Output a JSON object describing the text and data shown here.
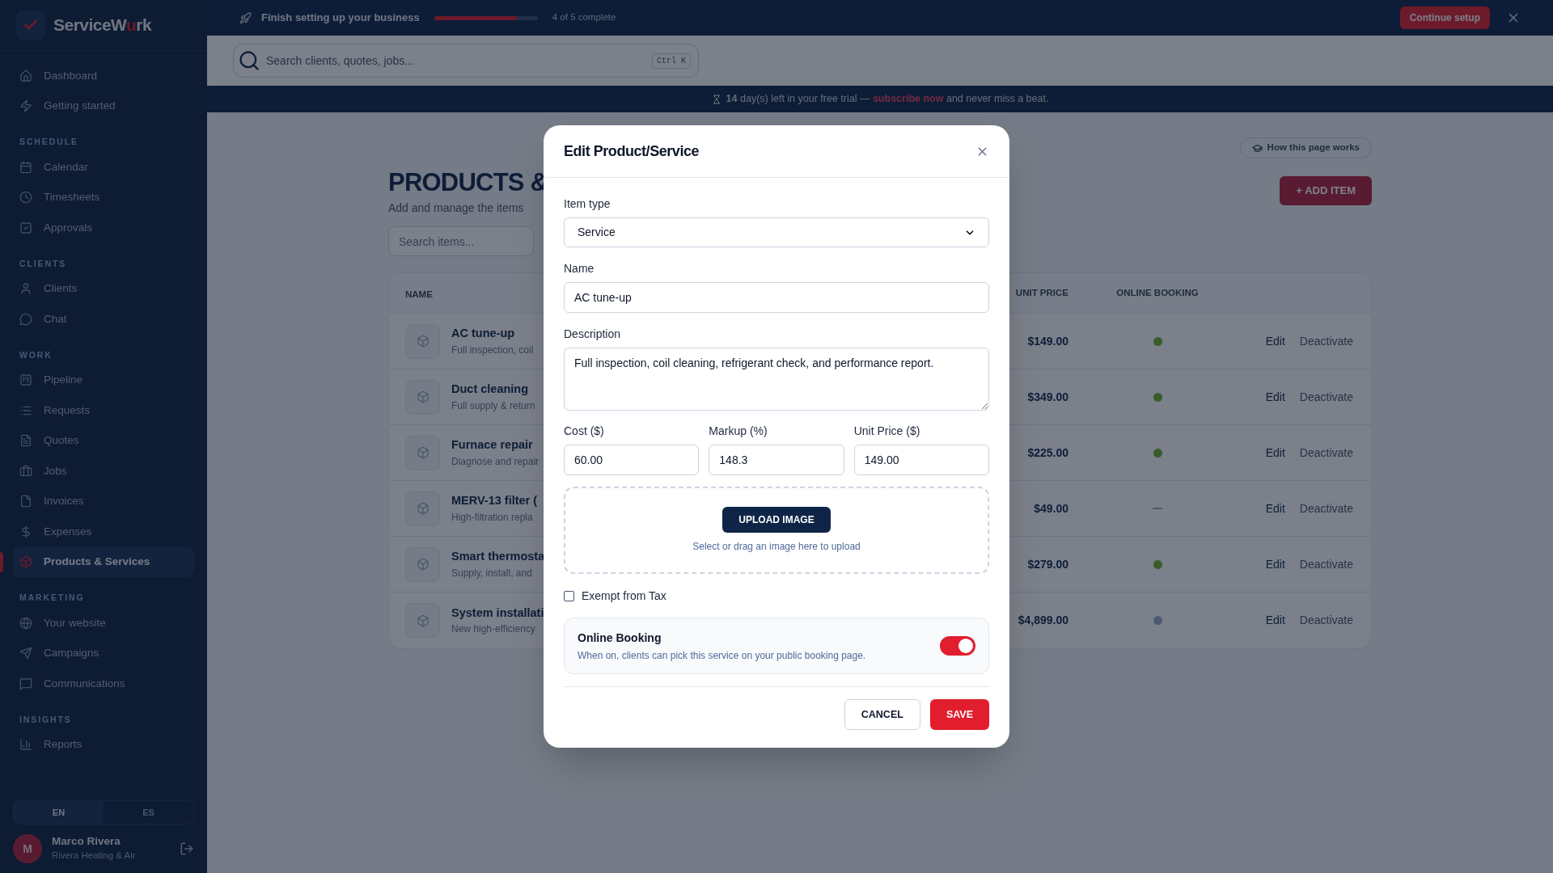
{
  "setup_bar": {
    "title": "Finish setting up your business",
    "level": 0.8,
    "progress_text": "4 of 5 complete",
    "button": "Continue setup"
  },
  "brand": {
    "name_start": "ServiceW",
    "name_accent": "u",
    "name_end": "rk"
  },
  "sidebar": {
    "sections": [
      {
        "items": [
          {
            "label": "Dashboard",
            "selected": false
          },
          {
            "label": "Getting started",
            "selected": false
          }
        ]
      },
      {
        "heading": "SCHEDULE",
        "items": [
          {
            "label": "Calendar",
            "selected": false
          },
          {
            "label": "Timesheets",
            "selected": false
          },
          {
            "label": "Approvals",
            "selected": false
          }
        ]
      },
      {
        "heading": "CLIENTS",
        "items": [
          {
            "label": "Clients",
            "selected": false
          },
          {
            "label": "Chat",
            "selected": false
          }
        ]
      },
      {
        "heading": "WORK",
        "items": [
          {
            "label": "Pipeline",
            "selected": false
          },
          {
            "label": "Requests",
            "selected": false
          },
          {
            "label": "Quotes",
            "selected": false
          },
          {
            "label": "Jobs",
            "selected": false
          },
          {
            "label": "Invoices",
            "selected": false
          },
          {
            "label": "Expenses",
            "selected": false
          },
          {
            "label": "Products & Services",
            "selected": true
          }
        ]
      },
      {
        "heading": "MARKETING",
        "items": [
          {
            "label": "Your website",
            "selected": false
          },
          {
            "label": "Campaigns",
            "selected": false
          },
          {
            "label": "Communications",
            "selected": false
          }
        ]
      },
      {
        "heading": "INSIGHTS",
        "items": [
          {
            "label": "Reports",
            "selected": false
          }
        ]
      }
    ]
  },
  "language": [
    {
      "label": "EN",
      "selected": true
    },
    {
      "label": "ES",
      "selected": false
    }
  ],
  "user": {
    "initial": "M",
    "name": "Marco Rivera",
    "company": "Rivera Heating & Air"
  },
  "search": {
    "placeholder": "Search clients, quotes, jobs...",
    "shortcut": "Ctrl K"
  },
  "trial_banner": {
    "text": "**14** day(s) left in your free trial — ",
    "link": "subscribe now",
    "text_after": " and never miss a beat."
  },
  "page": {
    "help_button": "How this page works",
    "title": "PRODUCTS &",
    "subtitle": "Add and manage the items",
    "add_button": "+ ADD ITEM",
    "search_placeholder": "Search items..."
  },
  "table": {
    "columns": [
      "NAME",
      "UNIT PRICE",
      "ONLINE BOOKING"
    ],
    "rows": [
      {
        "name": "AC tune-up",
        "description": "Full inspection, coil",
        "unit_price": "$149.00",
        "online_booking": true,
        "actions": [
          "Edit",
          "Deactivate"
        ]
      },
      {
        "name": "Duct cleaning",
        "description": "Full supply & return",
        "unit_price": "$349.00",
        "online_booking": true,
        "actions": [
          "Edit",
          "Deactivate"
        ]
      },
      {
        "name": "Furnace repair",
        "description": "Diagnose and repair",
        "unit_price": "$225.00",
        "online_booking": true,
        "actions": [
          "Edit",
          "Deactivate"
        ]
      },
      {
        "name": "MERV-13 filter (",
        "description": "High-filtration repla",
        "unit_price": "$49.00",
        "online_booking": null,
        "actions": [
          "Edit",
          "Deactivate"
        ]
      },
      {
        "name": "Smart thermosta",
        "description": "Supply, install, and",
        "unit_price": "$279.00",
        "online_booking": true,
        "actions": [
          "Edit",
          "Deactivate"
        ]
      },
      {
        "name": "System installati",
        "description": "New high-efficiency",
        "unit_price": "$4,899.00",
        "online_booking": false,
        "actions": [
          "Edit",
          "Deactivate"
        ]
      }
    ]
  },
  "modal": {
    "title": "Edit Product/Service",
    "item_type": {
      "label": "Item type",
      "value": "Service"
    },
    "name": {
      "label": "Name",
      "value": "AC tune-up"
    },
    "description": {
      "label": "Description",
      "value": "Full inspection, coil cleaning, refrigerant check, and performance report."
    },
    "pricing": [
      {
        "label": "Cost ($)",
        "value": "60.00"
      },
      {
        "label": "Markup (%)",
        "value": "148.3"
      },
      {
        "label": "Unit Price ($)",
        "value": "149.00"
      }
    ],
    "upload": {
      "button": "UPLOAD IMAGE",
      "hint": "Select or drag an image here to upload"
    },
    "exempt_from_tax": {
      "label": "Exempt from Tax",
      "checked": false
    },
    "online_booking": {
      "title": "Online Booking",
      "description": "When on, clients can pick this service on your public booking page.",
      "on": true
    },
    "buttons": {
      "cancel": "CANCEL",
      "save": "SAVE"
    }
  }
}
